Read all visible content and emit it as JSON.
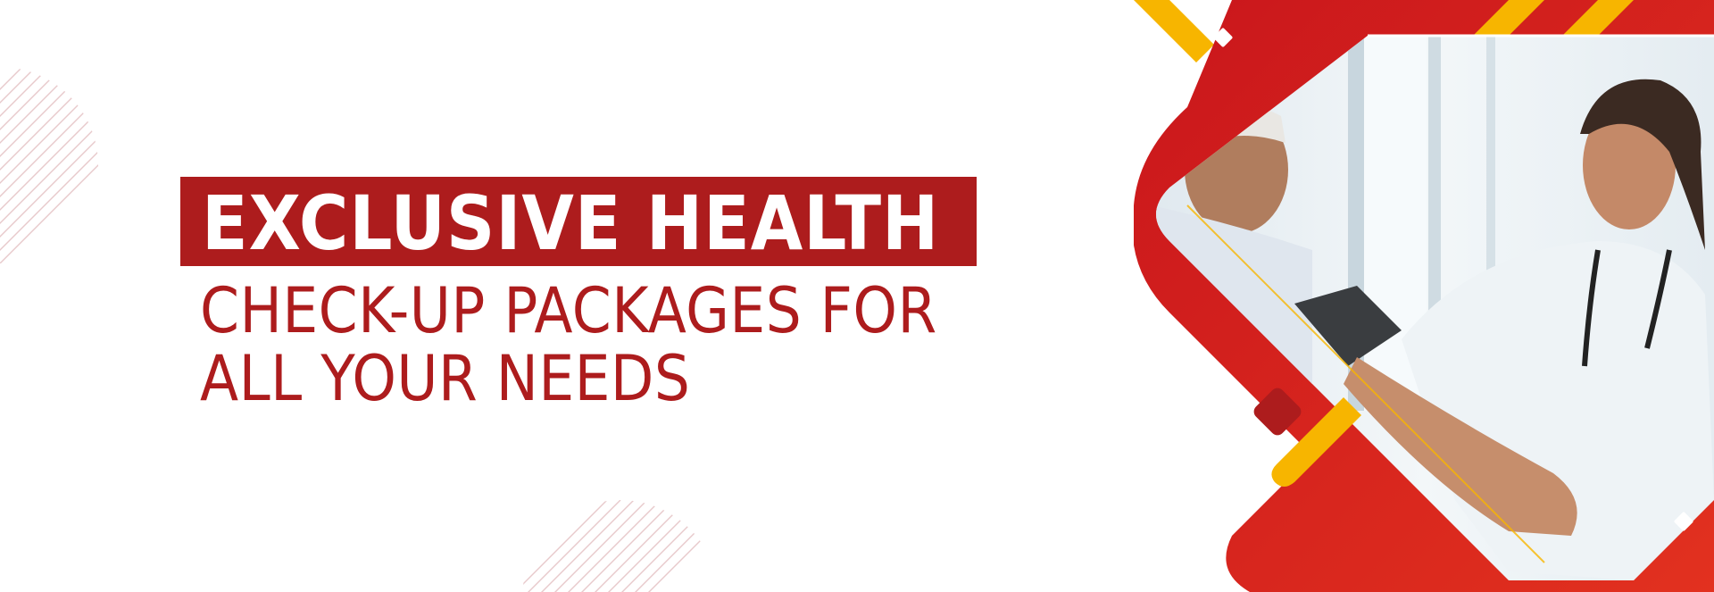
{
  "banner": {
    "headline": "EXCLUSIVE HEALTH",
    "subline_1": "CHECK-UP PACKAGES FOR",
    "subline_2": "ALL YOUR NEEDS"
  },
  "colors": {
    "brand_red": "#ad1c1d",
    "bright_red": "#e12b1f",
    "accent_yellow": "#f7b500",
    "background": "#ffffff",
    "hatch_lines": "#e8c9cb"
  },
  "image": {
    "subject": "doctor measuring a patient's blood pressure",
    "icon": "doctor-patient-photo"
  }
}
